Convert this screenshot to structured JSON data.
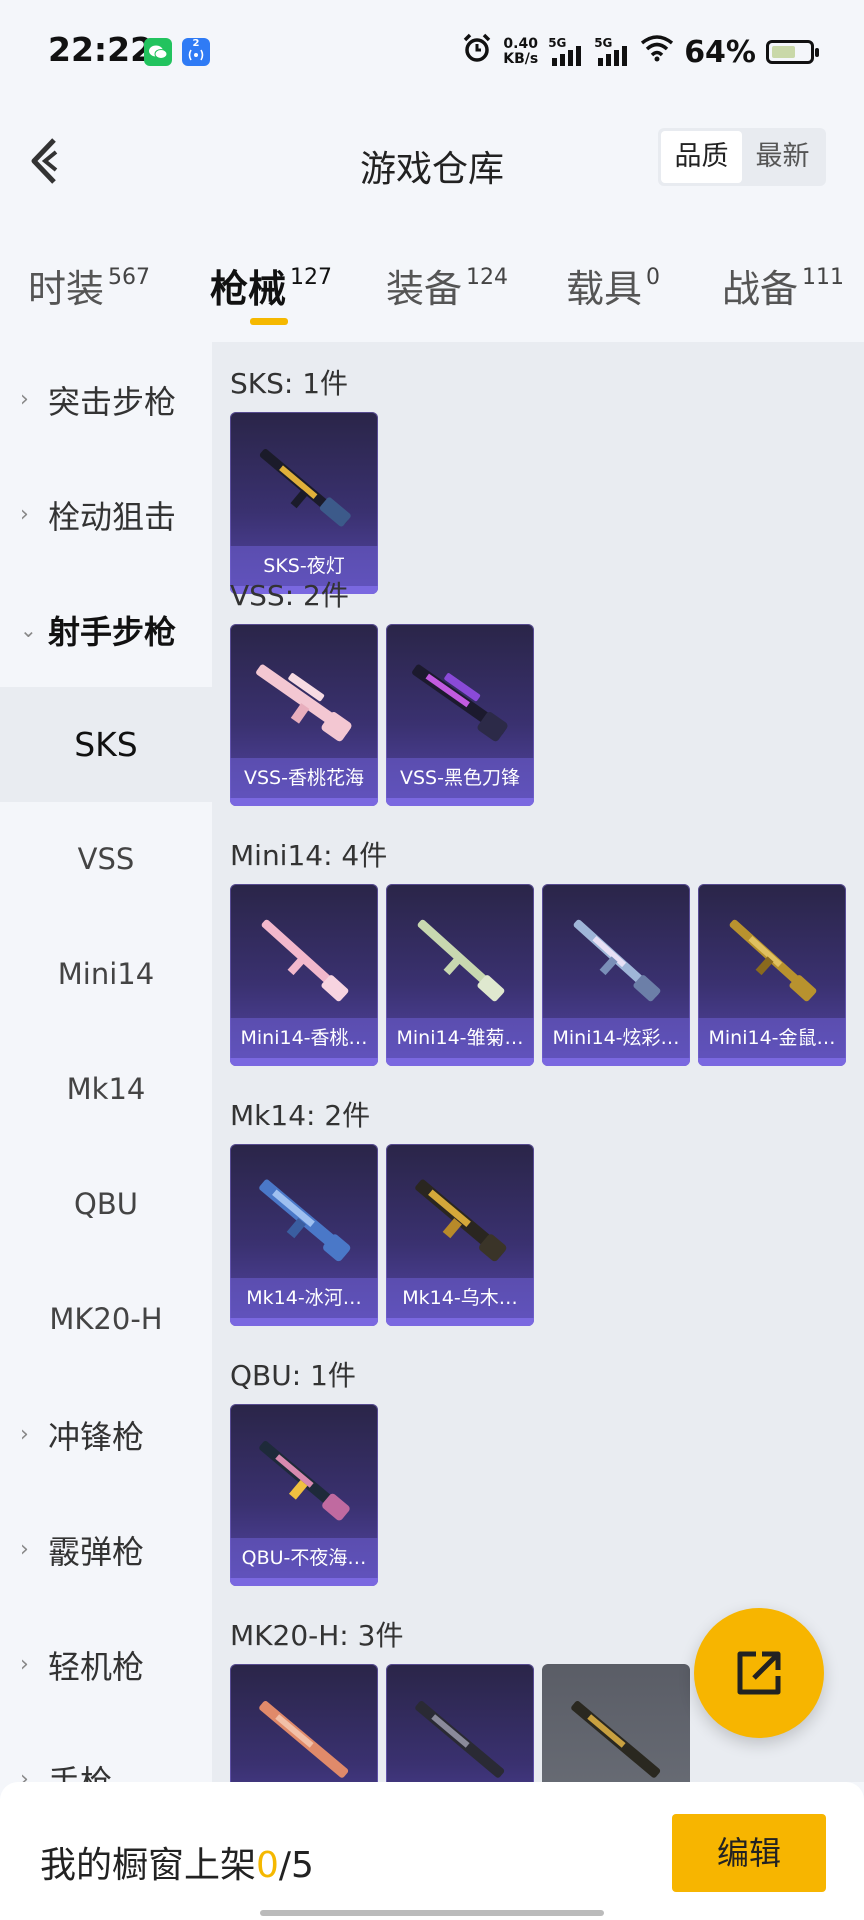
{
  "status_bar": {
    "time": "22:22",
    "app_icons": [
      "wechat-icon",
      "hotspot-icon"
    ],
    "hotspot_badge": "2",
    "net_speed_value": "0.40",
    "net_speed_unit": "KB/s",
    "sim1": "5G",
    "sim2": "5G",
    "battery": "64%",
    "battery_level": 0.64
  },
  "header": {
    "title": "游戏仓库",
    "sort_options": [
      "品质",
      "最新"
    ],
    "sort_selected": "品质"
  },
  "tabs": [
    {
      "label": "时装",
      "count": "567"
    },
    {
      "label": "枪械",
      "count": "127",
      "active": true
    },
    {
      "label": "装备",
      "count": "124"
    },
    {
      "label": "载具",
      "count": "0"
    },
    {
      "label": "战备",
      "count": "111"
    }
  ],
  "sidebar": {
    "categories": [
      {
        "label": "突击步枪"
      },
      {
        "label": "栓动狙击"
      },
      {
        "label": "射手步枪",
        "expanded": true
      }
    ],
    "subitems": [
      {
        "label": "SKS",
        "selected": true
      },
      {
        "label": "VSS"
      },
      {
        "label": "Mini14"
      },
      {
        "label": "Mk14"
      },
      {
        "label": "QBU"
      },
      {
        "label": "MK20-H"
      }
    ],
    "more_categories": [
      {
        "label": "冲锋枪"
      },
      {
        "label": "霰弹枪"
      },
      {
        "label": "轻机枪"
      },
      {
        "label": "手枪"
      }
    ]
  },
  "sections": [
    {
      "title": "SKS: 1件",
      "items": [
        {
          "name": "SKS-夜灯"
        }
      ]
    },
    {
      "title": "VSS: 2件",
      "items": [
        {
          "name": "VSS-香桃花海"
        },
        {
          "name": "VSS-黑色刀锋"
        }
      ]
    },
    {
      "title": "Mini14: 4件",
      "items": [
        {
          "name": "Mini14-香桃…"
        },
        {
          "name": "Mini14-雏菊…"
        },
        {
          "name": "Mini14-炫彩…"
        },
        {
          "name": "Mini14-金鼠…"
        }
      ]
    },
    {
      "title": "Mk14: 2件",
      "items": [
        {
          "name": "Mk14-冰河…"
        },
        {
          "name": "Mk14-乌木…"
        }
      ]
    },
    {
      "title": "QBU: 1件",
      "items": [
        {
          "name": "QBU-不夜海…"
        }
      ]
    },
    {
      "title": "MK20-H: 3件",
      "items": [
        {
          "name": ""
        },
        {
          "name": ""
        },
        {
          "name": ""
        }
      ]
    }
  ],
  "bottom": {
    "label": "我的橱窗上架",
    "current": "0",
    "total": "/5",
    "edit_label": "编辑"
  },
  "colors": {
    "accent": "#f7b500",
    "card_purple": "#3a3170",
    "background": "#f4f6fa"
  }
}
